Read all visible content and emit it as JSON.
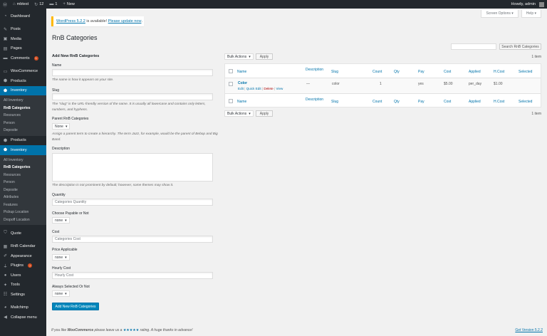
{
  "adminbar": {
    "site_name": "mbtest",
    "updates_count": "12",
    "comments_count": "1",
    "new_label": "New",
    "howdy": "Howdy, admin"
  },
  "sidebar": {
    "top_items": [
      {
        "label": "Dashboard",
        "icon": "dashboard-icon"
      },
      {
        "label": "Posts",
        "icon": "pin-icon"
      },
      {
        "label": "Media",
        "icon": "media-icon"
      },
      {
        "label": "Pages",
        "icon": "pages-icon"
      },
      {
        "label": "Comments",
        "icon": "comments-icon",
        "badge": "1"
      },
      {
        "label": "WooCommerce",
        "icon": "woocommerce-icon"
      },
      {
        "label": "Products",
        "icon": "products-icon"
      },
      {
        "label": "Inventory",
        "icon": "inventory-icon"
      }
    ],
    "sub1": [
      "All Inventory",
      "RnB Categories",
      "Resources",
      "Person",
      "Deposite"
    ],
    "products2": "Products",
    "inventory2": "Inventory",
    "sub2": [
      "All Inventory",
      "RnB Categories",
      "Resources",
      "Person",
      "Deposite",
      "Attributes",
      "Features",
      "Pickup Location",
      "Dropoff Location"
    ],
    "bottom_items": [
      {
        "label": "Quote",
        "icon": "quote-icon"
      },
      {
        "label": "RnB Calendar",
        "icon": "calendar-icon"
      },
      {
        "label": "Appearance",
        "icon": "appearance-icon"
      },
      {
        "label": "Plugins",
        "icon": "plugins-icon",
        "badge": "7"
      },
      {
        "label": "Users",
        "icon": "users-icon"
      },
      {
        "label": "Tools",
        "icon": "tools-icon"
      },
      {
        "label": "Settings",
        "icon": "settings-icon"
      },
      {
        "label": "Mailchimp",
        "icon": "mailchimp-icon"
      },
      {
        "label": "Collapse menu",
        "icon": "collapse-icon"
      }
    ]
  },
  "screen_options": "Screen Options ▾",
  "help": "Help ▾",
  "notice": {
    "link1": "WordPress 5.2.2",
    "middle": " is available! ",
    "link2": "Please update now",
    "end": "."
  },
  "page_title": "RnB Categories",
  "search_button": "Search RnB Categories",
  "form": {
    "heading": "Add New RnB Categories",
    "name_label": "Name",
    "name_desc": "The name is how it appears on your site.",
    "slug_label": "Slug",
    "slug_desc": "The “slug” is the URL-friendly version of the name. It is usually all lowercase and contains only letters, numbers, and hyphens.",
    "parent_label": "Parent RnB Categories",
    "parent_value": "None",
    "parent_desc": "Assign a parent term to create a hierarchy. The term Jazz, for example, would be the parent of Bebop and Big Band.",
    "description_label": "Description",
    "description_desc": "The description is not prominent by default; however, some themes may show it.",
    "quantity_label": "Quantity",
    "quantity_placeholder": "Categories Quantity",
    "payable_label": "Choose Payable or Not",
    "payable_value": "none",
    "cost_label": "Cost",
    "cost_placeholder": "Categories Cost",
    "price_label": "Price Applicable",
    "price_value": "none",
    "hourly_label": "Hourly Cost",
    "hourly_placeholder": "Hourly Cost",
    "always_label": "Always Selected Or Not",
    "always_value": "none",
    "submit": "Add New RnB Categories"
  },
  "tablenav": {
    "bulk": "Bulk Actions",
    "apply": "Apply",
    "items": "1 item"
  },
  "table": {
    "headers": [
      "Name",
      "Description",
      "Slug",
      "Count",
      "Qty",
      "Pay",
      "Cost",
      "Applied",
      "H.Cost",
      "Selected"
    ],
    "row": {
      "name": "Color",
      "description": "—",
      "slug": "color",
      "count": "1",
      "qty": "",
      "pay": "yes",
      "cost": "$5.00",
      "applied": "per_day",
      "hcost": "$1.00",
      "selected": ""
    },
    "actions": {
      "edit": "Edit",
      "quick": "Quick Edit",
      "delete": "Delete",
      "view": "View"
    }
  },
  "footer": {
    "pre": "If you like ",
    "brand": "WooCommerce",
    "mid": " please leave us a ",
    "stars": "★★★★★",
    "post": " rating. A huge thanks in advance!",
    "version": "Get Version 5.2.2"
  }
}
